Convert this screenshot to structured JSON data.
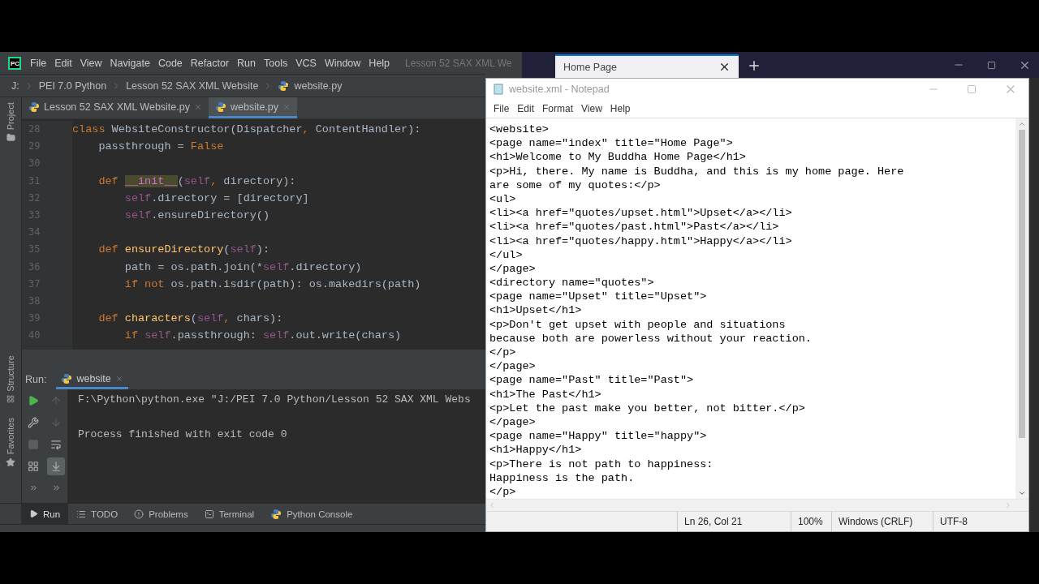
{
  "ide": {
    "logo_text": "PC",
    "menu": [
      "File",
      "Edit",
      "View",
      "Navigate",
      "Code",
      "Refactor",
      "Run",
      "Tools",
      "VCS",
      "Window",
      "Help"
    ],
    "title": "Lesson 52 SAX XML We",
    "breadcrumbs": [
      "J:",
      "PEI 7.0 Python",
      "Lesson 52 SAX XML Website",
      "website.py"
    ],
    "side_tabs": [
      "Project"
    ],
    "editor_tabs": [
      {
        "label": "Lesson 52 SAX XML Website.py",
        "selected": false
      },
      {
        "label": "website.py",
        "selected": true
      }
    ],
    "code_lines": [
      {
        "number": "28",
        "tokens": [
          {
            "kind": "kw",
            "text": "class "
          },
          {
            "kind": "plain",
            "text": "WebsiteConstructor(Dispatcher"
          },
          {
            "kind": "kw",
            "text": ", "
          },
          {
            "kind": "plain",
            "text": "ContentHandler):"
          }
        ]
      },
      {
        "number": "29",
        "tokens": [
          {
            "kind": "plain",
            "text": "    passthrough = "
          },
          {
            "kind": "kw",
            "text": "False"
          }
        ]
      },
      {
        "number": "30"
      },
      {
        "number": "31",
        "tokens": [
          {
            "kind": "kw",
            "text": "    def "
          },
          {
            "kind": "magic",
            "text": "__init__"
          },
          {
            "kind": "plain",
            "text": "("
          },
          {
            "kind": "self",
            "text": "self"
          },
          {
            "kind": "kw",
            "text": ", "
          },
          {
            "kind": "plain",
            "text": "directory):"
          }
        ]
      },
      {
        "number": "32",
        "tokens": [
          {
            "kind": "self",
            "text": "        self"
          },
          {
            "kind": "plain",
            "text": ".directory = [directory]"
          }
        ]
      },
      {
        "number": "33",
        "tokens": [
          {
            "kind": "self",
            "text": "        self"
          },
          {
            "kind": "plain",
            "text": ".ensureDirectory()"
          }
        ]
      },
      {
        "number": "34"
      },
      {
        "number": "35",
        "tokens": [
          {
            "kind": "kw",
            "text": "    def "
          },
          {
            "kind": "fn",
            "text": "ensureDirectory"
          },
          {
            "kind": "plain",
            "text": "("
          },
          {
            "kind": "self",
            "text": "self"
          },
          {
            "kind": "plain",
            "text": "):"
          }
        ]
      },
      {
        "number": "36",
        "tokens": [
          {
            "kind": "plain",
            "text": "        path = os.path.join(*"
          },
          {
            "kind": "self",
            "text": "self"
          },
          {
            "kind": "plain",
            "text": ".directory)"
          }
        ]
      },
      {
        "number": "37",
        "tokens": [
          {
            "kind": "kw",
            "text": "        if not "
          },
          {
            "kind": "plain",
            "text": "os.path.isdir(path): os.makedirs(path)"
          }
        ]
      },
      {
        "number": "38"
      },
      {
        "number": "39",
        "tokens": [
          {
            "kind": "kw",
            "text": "    def "
          },
          {
            "kind": "fn",
            "text": "characters"
          },
          {
            "kind": "plain",
            "text": "("
          },
          {
            "kind": "self",
            "text": "self"
          },
          {
            "kind": "kw",
            "text": ", "
          },
          {
            "kind": "plain",
            "text": "chars):"
          }
        ]
      },
      {
        "number": "40",
        "tokens": [
          {
            "kind": "kw",
            "text": "        if "
          },
          {
            "kind": "self",
            "text": "self"
          },
          {
            "kind": "plain",
            "text": ".passthrough: "
          },
          {
            "kind": "self",
            "text": "self"
          },
          {
            "kind": "plain",
            "text": ".out.write(chars)"
          }
        ]
      }
    ],
    "run_label": "Run:",
    "run_tab": "website",
    "run_tools": [
      {
        "kind": "run",
        "disabled": false,
        "on": false
      },
      {
        "kind": "up",
        "disabled": true,
        "on": false
      },
      {
        "kind": "wrench",
        "disabled": false,
        "on": false
      },
      {
        "kind": "down",
        "disabled": true,
        "on": false
      },
      {
        "kind": "stop",
        "disabled": true,
        "on": false
      },
      {
        "kind": "wrap",
        "disabled": false,
        "on": false
      },
      {
        "kind": "layout",
        "disabled": false,
        "on": false
      },
      {
        "kind": "scroll",
        "disabled": false,
        "on": true
      },
      {
        "kind": "more",
        "disabled": false,
        "on": false
      },
      {
        "kind": "more",
        "disabled": false,
        "on": false
      }
    ],
    "output": [
      "F:\\Python\\python.exe \"J:/PEI 7.0 Python/Lesson 52 SAX XML Webs",
      "Process finished with exit code 0"
    ],
    "left_tools": [
      "Structure",
      "Favorites"
    ],
    "bottom_tabs": [
      {
        "label": "Run",
        "kind": "run",
        "selected": true
      },
      {
        "label": "TODO",
        "kind": "todo",
        "selected": false
      },
      {
        "label": "Problems",
        "kind": "problems",
        "selected": false
      },
      {
        "label": "Terminal",
        "kind": "terminal",
        "selected": false
      },
      {
        "label": "Python Console",
        "kind": "console",
        "selected": false
      }
    ]
  },
  "browser": {
    "tab": "Home Page"
  },
  "notepad": {
    "title": "website.xml - Notepad",
    "menu": [
      "File",
      "Edit",
      "Format",
      "View",
      "Help"
    ],
    "lines": [
      "<website>",
      "<page name=\"index\" title=\"Home Page\">",
      "<h1>Welcome to My Buddha Home Page</h1>",
      "<p>Hi, there. My name is Buddha, and this is my home page. Here",
      "are some of my quotes:</p>",
      "<ul>",
      "<li><a href=\"quotes/upset.html\">Upset</a></li>",
      "<li><a href=\"quotes/past.html\">Past</a></li>",
      "<li><a href=\"quotes/happy.html\">Happy</a></li>",
      "</ul>",
      "</page>",
      "<directory name=\"quotes\">",
      "<page name=\"Upset\" title=\"Upset\">",
      "<h1>Upset</h1>",
      "<p>Don't get upset with people and situations",
      "because both are powerless without your reaction.",
      "</p>",
      "</page>",
      "<page name=\"Past\" title=\"Past\">",
      "<h1>The Past</h1>",
      "<p>Let the past make you better, not bitter.</p>",
      "</page>",
      "<page name=\"Happy\" title=\"happy\">",
      "<h1>Happy</h1>",
      "<p>There is not path to happiness:",
      "Happiness is the path.",
      "</p>"
    ],
    "status": [
      "Ln 26, Col 21",
      "100%",
      "Windows (CRLF)",
      "UTF-8"
    ]
  }
}
